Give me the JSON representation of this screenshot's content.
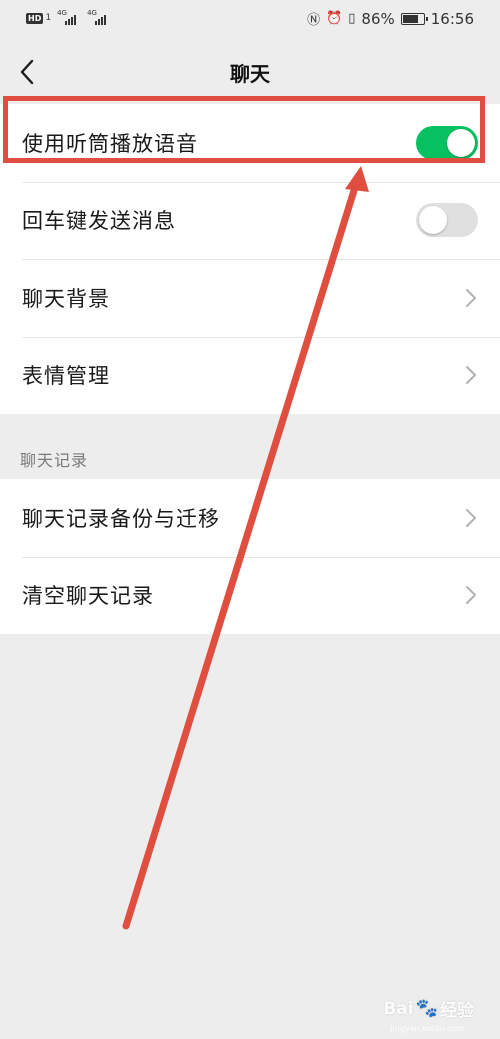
{
  "status_bar": {
    "hd_label": "HD",
    "sim_number": "1",
    "network_1": "4G",
    "network_2": "4G",
    "battery_percent": "86%",
    "battery_level": 0.86,
    "time": "16:56"
  },
  "header": {
    "title": "聊天"
  },
  "settings": {
    "general": [
      {
        "label": "使用听筒播放语音",
        "control": "toggle",
        "on": true
      },
      {
        "label": "回车键发送消息",
        "control": "toggle",
        "on": false
      },
      {
        "label": "聊天背景",
        "control": "chevron"
      },
      {
        "label": "表情管理",
        "control": "chevron"
      }
    ],
    "history_section_title": "聊天记录",
    "history": [
      {
        "label": "聊天记录备份与迁移",
        "control": "chevron"
      },
      {
        "label": "清空聊天记录",
        "control": "chevron"
      }
    ]
  },
  "colors": {
    "toggle_on": "#07c160",
    "toggle_off": "#e0e0e0",
    "annotation": "#e04e3f",
    "background": "#ededed"
  },
  "watermark": {
    "brand": "Bai",
    "brand_suffix": "经验",
    "url": "jingyan.baidu.com"
  }
}
